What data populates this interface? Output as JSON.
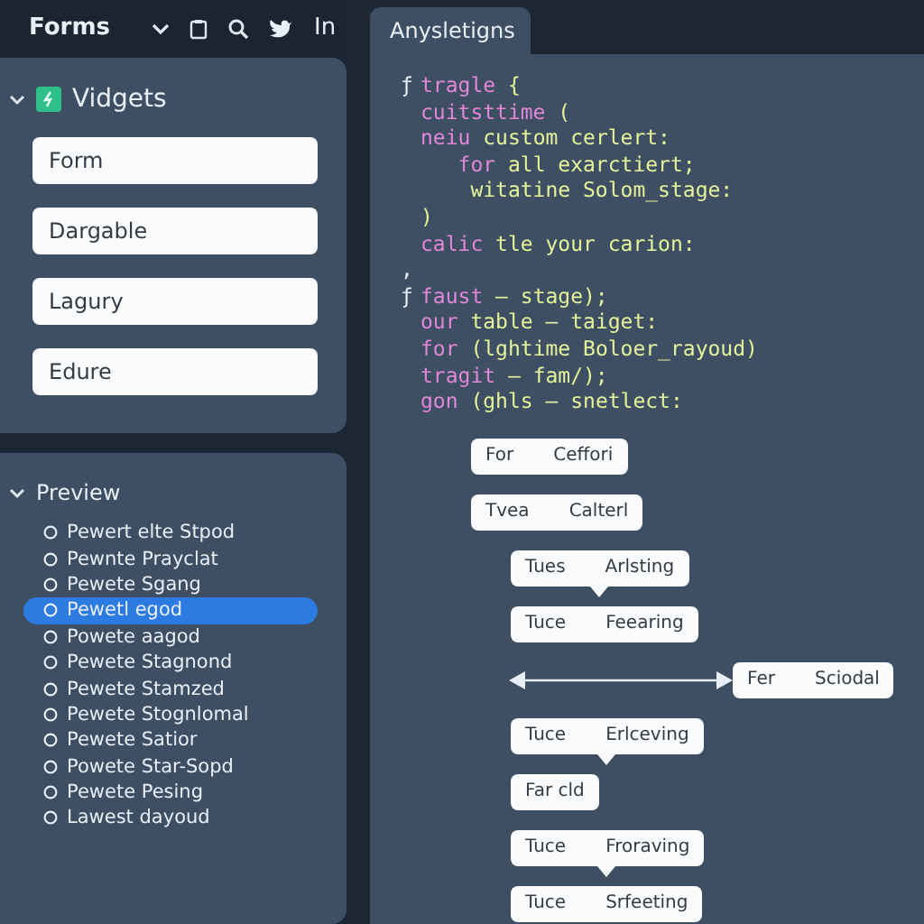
{
  "topbar": {
    "title": "Forms",
    "linkedin": "In"
  },
  "widgets": {
    "title": "Vidgets",
    "expanded": true,
    "fields": [
      "Form",
      "Dargable",
      "Lagury",
      "Edure"
    ]
  },
  "preview": {
    "title": "Preview",
    "expanded": true,
    "items": [
      {
        "label": "Pewert elte Stpod",
        "selected": false
      },
      {
        "label": "Pewnte Prayclat",
        "selected": false
      },
      {
        "label": "Pewete Sgang",
        "selected": false
      },
      {
        "label": "Pewetl egod",
        "selected": true
      },
      {
        "label": "Powete aagod",
        "selected": false
      },
      {
        "label": "Pewete Stagnond",
        "selected": false
      },
      {
        "label": "Pewete Stamzed",
        "selected": false
      },
      {
        "label": "Pewete Stognlomal",
        "selected": false
      },
      {
        "label": "Pewete Satior",
        "selected": false
      },
      {
        "label": "Powete Star-Sopd",
        "selected": false
      },
      {
        "label": "Pewete Pesing",
        "selected": false
      },
      {
        "label": "Lawest dayoud",
        "selected": false
      }
    ]
  },
  "editor": {
    "tab": "Anysletigns",
    "code": [
      {
        "gutter": "ƒ",
        "segments": [
          {
            "kind": "kw",
            "text": "tragle"
          },
          {
            "kind": "text",
            "text": " {"
          }
        ]
      },
      {
        "segments": [
          {
            "kind": "kw",
            "text": "cuitsttime"
          },
          {
            "kind": "text",
            "text": " ("
          }
        ]
      },
      {
        "segments": [
          {
            "kind": "kw",
            "text": "neiu"
          },
          {
            "kind": "text",
            "text": " custom cerlert:"
          }
        ]
      },
      {
        "segments": [
          {
            "kind": "kw",
            "text": "   for"
          },
          {
            "kind": "text",
            "text": " all exarctiert;"
          }
        ]
      },
      {
        "segments": [
          {
            "kind": "text",
            "text": "    witatine Solom_stage:"
          }
        ]
      },
      {
        "segments": [
          {
            "kind": "text",
            "text": ")"
          }
        ]
      },
      {
        "segments": [
          {
            "kind": "kw",
            "text": "calic"
          },
          {
            "kind": "text",
            "text": " tle your carion:"
          }
        ]
      },
      {
        "gutter": ","
      },
      {
        "gutter": "ƒ",
        "segments": [
          {
            "kind": "kw",
            "text": "faust"
          },
          {
            "kind": "text",
            "text": " – stage);"
          }
        ]
      },
      {
        "segments": [
          {
            "kind": "kw",
            "text": "our"
          },
          {
            "kind": "text",
            "text": " table – taiget:"
          }
        ]
      },
      {
        "segments": [
          {
            "kind": "kw",
            "text": "for"
          },
          {
            "kind": "text",
            "text": " (lghtime Boloer_rayoud)"
          }
        ]
      },
      {
        "segments": [
          {
            "kind": "kw",
            "text": "tragit"
          },
          {
            "kind": "text",
            "text": " – fam/);"
          }
        ]
      },
      {
        "segments": [
          {
            "kind": "kw",
            "text": "gon"
          },
          {
            "kind": "text",
            "text": " (ghls – snetlect:"
          }
        ]
      }
    ],
    "flow": [
      {
        "kind": "box",
        "left": "For",
        "right": "Ceffori"
      },
      {
        "kind": "box",
        "left": "Tvea",
        "right": "Calterl",
        "children": [
          {
            "kind": "callout",
            "left": "Tues",
            "right": "Arlsting"
          },
          {
            "kind": "box",
            "left": "Tuce",
            "right": "Feearing"
          },
          {
            "kind": "arrow",
            "left": "Fer",
            "right": "Sciodal"
          },
          {
            "kind": "callout",
            "left": "Tuce",
            "right": "Erlceving"
          },
          {
            "kind": "box",
            "left": "Far cld"
          },
          {
            "kind": "callout",
            "left": "Tuce",
            "right": "Froraving"
          },
          {
            "kind": "box",
            "left": "Tuce",
            "right": "Srfeeting"
          }
        ]
      }
    ]
  }
}
